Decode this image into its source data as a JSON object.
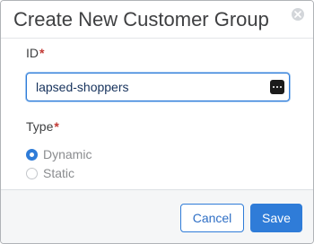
{
  "dialog": {
    "title": "Create New Customer Group",
    "close_icon": "close-icon"
  },
  "form": {
    "id_field": {
      "label": "ID",
      "required_mark": "*",
      "value": "lapsed-shoppers",
      "action_icon": "more-dots-icon"
    },
    "type_field": {
      "label": "Type",
      "required_mark": "*",
      "options": [
        {
          "label": "Dynamic",
          "selected": true
        },
        {
          "label": "Static",
          "selected": false
        }
      ]
    }
  },
  "footer": {
    "cancel_label": "Cancel",
    "save_label": "Save"
  },
  "colors": {
    "accent": "#2f7cd8",
    "required": "#c23934",
    "title": "#3f4042",
    "footer_bg": "#f5f6f7"
  }
}
